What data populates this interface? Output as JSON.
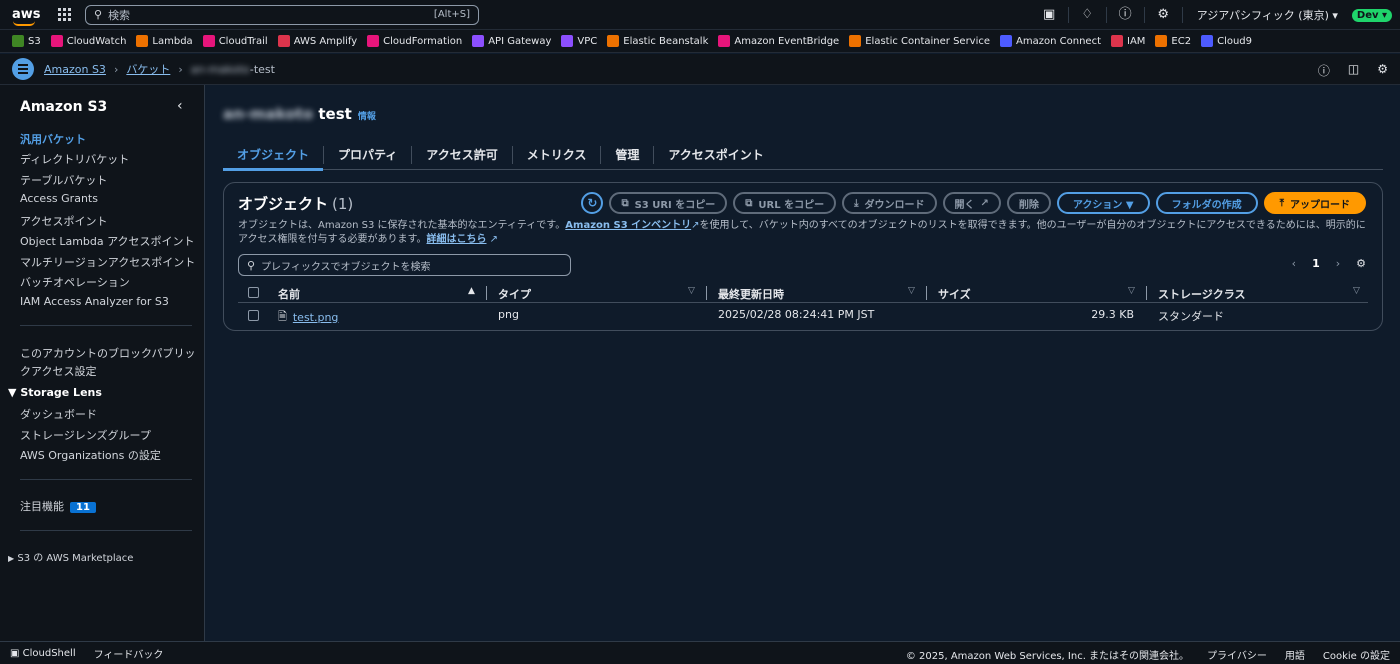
{
  "topbar": {
    "search_placeholder": "検索",
    "search_shortcut": "[Alt+S]",
    "region": "アジアパシフィック (東京) ▾",
    "account_badge": "Dev ▾",
    "icons": [
      "cloudshell-icon",
      "bell-icon",
      "help-icon",
      "gear-icon"
    ]
  },
  "favorites": [
    {
      "label": "S3",
      "color": "#3f8624"
    },
    {
      "label": "CloudWatch",
      "color": "#e7157b"
    },
    {
      "label": "Lambda",
      "color": "#ed7100"
    },
    {
      "label": "CloudTrail",
      "color": "#e7157b"
    },
    {
      "label": "AWS Amplify",
      "color": "#dd344c"
    },
    {
      "label": "CloudFormation",
      "color": "#e7157b"
    },
    {
      "label": "API Gateway",
      "color": "#8c4fff"
    },
    {
      "label": "VPC",
      "color": "#8c4fff"
    },
    {
      "label": "Elastic Beanstalk",
      "color": "#ed7100"
    },
    {
      "label": "Amazon EventBridge",
      "color": "#e7157b"
    },
    {
      "label": "Elastic Container Service",
      "color": "#ed7100"
    },
    {
      "label": "Amazon Connect",
      "color": "#4d5bff"
    },
    {
      "label": "IAM",
      "color": "#dd344c"
    },
    {
      "label": "EC2",
      "color": "#ed7100"
    },
    {
      "label": "Cloud9",
      "color": "#4d5bff"
    }
  ],
  "breadcrumb": {
    "root": "Amazon S3",
    "buckets": "バケット",
    "current_prefix": "an-makoto",
    "current_suffix": "-test"
  },
  "sidebar": {
    "title": "Amazon S3",
    "items": [
      "汎用バケット",
      "ディレクトリバケット",
      "テーブルバケット",
      "Access Grants",
      "アクセスポイント",
      "Object Lambda アクセスポイント",
      "マルチリージョンアクセスポイント",
      "バッチオペレーション",
      "IAM Access Analyzer for S3"
    ],
    "block_public_line1": "このアカウントのブロックパブリッ",
    "block_public_line2": "クアクセス設定",
    "storage_lens": "Storage Lens",
    "storage_lens_items": [
      "ダッシュボード",
      "ストレージレンズグループ",
      "AWS Organizations の設定"
    ],
    "featured": "注目機能",
    "featured_count": "11",
    "marketplace": "S3 の AWS Marketplace"
  },
  "main": {
    "bucket_name_prefix": "an-makoto",
    "bucket_name_suffix": "test",
    "info": "情報",
    "tabs": [
      "オブジェクト",
      "プロパティ",
      "アクセス許可",
      "メトリクス",
      "管理",
      "アクセスポイント"
    ],
    "panel": {
      "title": "オブジェクト",
      "count": "(1)",
      "buttons": {
        "copy_s3_uri": "S3 URI をコピー",
        "copy_url": "URL をコピー",
        "download": "ダウンロード",
        "open": "開く",
        "delete": "削除",
        "actions": "アクション ▼",
        "create_folder": "フォルダの作成",
        "upload": "アップロード"
      },
      "desc_1": "オブジェクトは、Amazon S3 に保存された基本的なエンティティです。",
      "desc_link": "Amazon S3 インベントリ",
      "desc_2": "を使用して、バケット内のすべてのオブジェクトのリストを取得できます。他のユーザーが自分のオブジェクトにアクセスできるためには、明示的にアクセス権限を付与する必要があります。",
      "desc_more": "詳細はこちら",
      "filter_placeholder": "プレフィックスでオブジェクトを検索",
      "page": "1",
      "columns": [
        "名前",
        "タイプ",
        "最終更新日時",
        "サイズ",
        "ストレージクラス"
      ],
      "rows": [
        {
          "name": "test.png",
          "type": "png",
          "modified": "2025/02/28 08:24:41 PM JST",
          "size": "29.3 KB",
          "storage_class": "スタンダード"
        }
      ]
    }
  },
  "footer": {
    "cloudshell": "CloudShell",
    "feedback": "フィードバック",
    "copyright": "© 2025, Amazon Web Services, Inc. またはその関連会社。",
    "privacy": "プライバシー",
    "terms": "用語",
    "cookie": "Cookie の設定"
  }
}
